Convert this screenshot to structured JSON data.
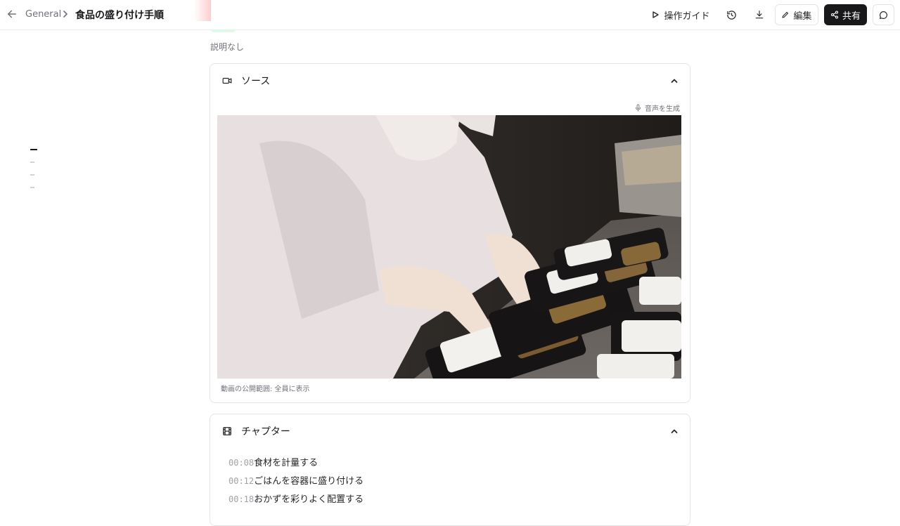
{
  "header": {
    "breadcrumb_parent": "General",
    "title": "食品の盛り付け手順",
    "guide_label": "操作ガイド",
    "edit_label": "編集",
    "share_label": "共有"
  },
  "description": "説明なし",
  "source": {
    "title": "ソース",
    "generate_audio_label": "音声を生成",
    "visibility": "動画の公開範囲: 全員に表示"
  },
  "chapters": {
    "title": "チャプター",
    "items": [
      {
        "time": "00:08",
        "label": "食材を計量する"
      },
      {
        "time": "00:12",
        "label": "ごはんを容器に盛り付ける"
      },
      {
        "time": "00:18",
        "label": "おかずを彩りよく配置する"
      }
    ]
  },
  "colors": {
    "primary_button": "#18181b",
    "border": "#e4e4e7",
    "muted_text": "#71717a"
  }
}
